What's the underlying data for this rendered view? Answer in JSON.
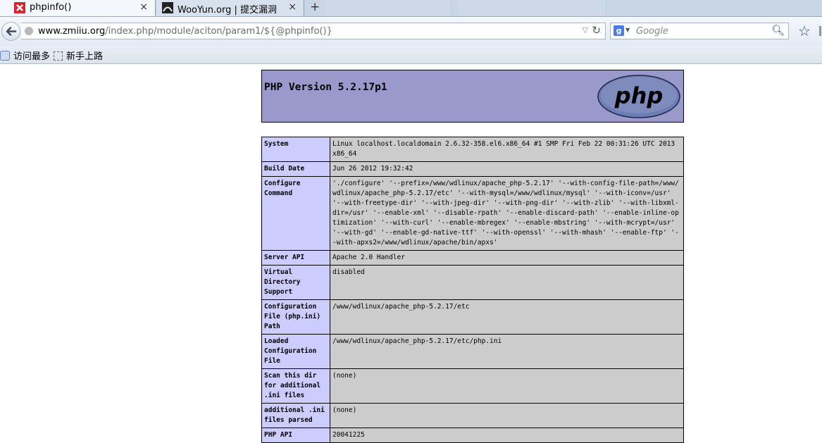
{
  "tabs": [
    {
      "title": "phpinfo()",
      "active": true,
      "icon": "red-x-favicon"
    },
    {
      "title": "WooYun.org | 提交漏洞",
      "active": false,
      "icon": "wooyun-favicon"
    }
  ],
  "new_tab_symbol": "+",
  "close_symbol": "×",
  "nav": {
    "url_domain": "www.zmiiu.org",
    "url_path": "/index.php/module/aciton/param1/${@phpinfo()}",
    "search_placeholder": "Google"
  },
  "bookmarks": [
    {
      "label": "访问最多"
    },
    {
      "label": "新手上路"
    }
  ],
  "php": {
    "version_title": "PHP Version 5.2.17p1",
    "logo_text": "php",
    "rows": [
      {
        "label": "System",
        "value": "Linux localhost.localdomain 2.6.32-358.el6.x86_64 #1 SMP Fri Feb 22 00:31:26 UTC 2013 x86_64"
      },
      {
        "label": "Build Date",
        "value": "Jun 26 2012 19:32:42"
      },
      {
        "label": "Configure Command",
        "value": "'./configure' '--prefix=/www/wdlinux/apache_php-5.2.17' '--with-config-file-path=/www/wdlinux/apache_php-5.2.17/etc' '--with-mysql=/www/wdlinux/mysql' '--with-iconv=/usr' '--with-freetype-dir' '--with-jpeg-dir' '--with-png-dir' '--with-zlib' '--with-libxml-dir=/usr' '--enable-xml' '--disable-rpath' '--enable-discard-path' '--enable-inline-optimization' '--with-curl' '--enable-mbregex' '--enable-mbstring' '--with-mcrypt=/usr' '--with-gd' '--enable-gd-native-ttf' '--with-openssl' '--with-mhash' '--enable-ftp' '--with-apxs2=/www/wdlinux/apache/bin/apxs'"
      },
      {
        "label": "Server API",
        "value": "Apache 2.0 Handler"
      },
      {
        "label": "Virtual Directory Support",
        "value": "disabled"
      },
      {
        "label": "Configuration File (php.ini) Path",
        "value": "/www/wdlinux/apache_php-5.2.17/etc"
      },
      {
        "label": "Loaded Configuration File",
        "value": "/www/wdlinux/apache_php-5.2.17/etc/php.ini"
      },
      {
        "label": "Scan this dir for additional .ini files",
        "value": "(none)"
      },
      {
        "label": "additional .ini files parsed",
        "value": "(none)"
      },
      {
        "label": "PHP API",
        "value": "20041225"
      }
    ]
  },
  "colors": {
    "header_bg": "#9999cc",
    "label_bg": "#ccccff",
    "value_bg": "#cccccc"
  }
}
